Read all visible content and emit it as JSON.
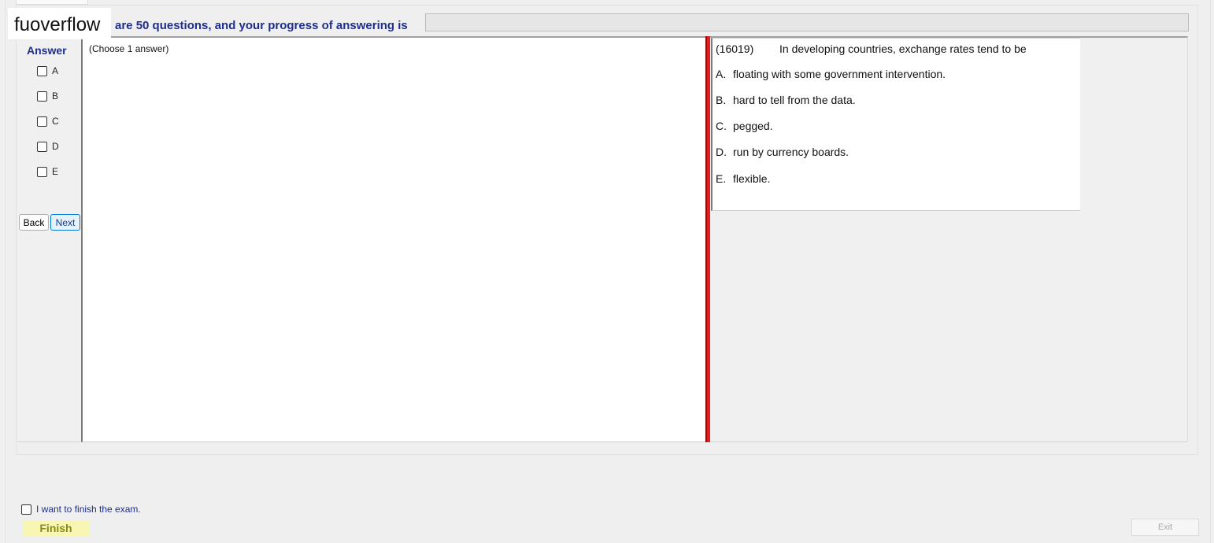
{
  "logo": {
    "text": "fuoverflow"
  },
  "header": {
    "progress_text": "are 50 questions, and your progress of answering is",
    "progress_value": 0
  },
  "answer_panel": {
    "title": "Answer",
    "options": [
      "A",
      "B",
      "C",
      "D",
      "E"
    ],
    "back_label": "Back",
    "next_label": "Next"
  },
  "explain": {
    "choose_text": "(Choose 1 answer)"
  },
  "question": {
    "id": "(16019)",
    "stem": "In developing countries, exchange rates tend to be",
    "options": [
      {
        "letter": "A.",
        "text": "floating with some government intervention."
      },
      {
        "letter": "B.",
        "text": "hard to tell from the data."
      },
      {
        "letter": "C.",
        "text": "pegged."
      },
      {
        "letter": "D.",
        "text": "run by currency boards."
      },
      {
        "letter": "E.",
        "text": "flexible."
      }
    ]
  },
  "footer": {
    "finish_check_label": "I want to finish the exam.",
    "finish_label": "Finish",
    "exit_label": "Exit"
  },
  "colors": {
    "accent_blue": "#1d2f8a",
    "divider_red": "#e0201e",
    "finish_bg": "#f7f7b3"
  }
}
